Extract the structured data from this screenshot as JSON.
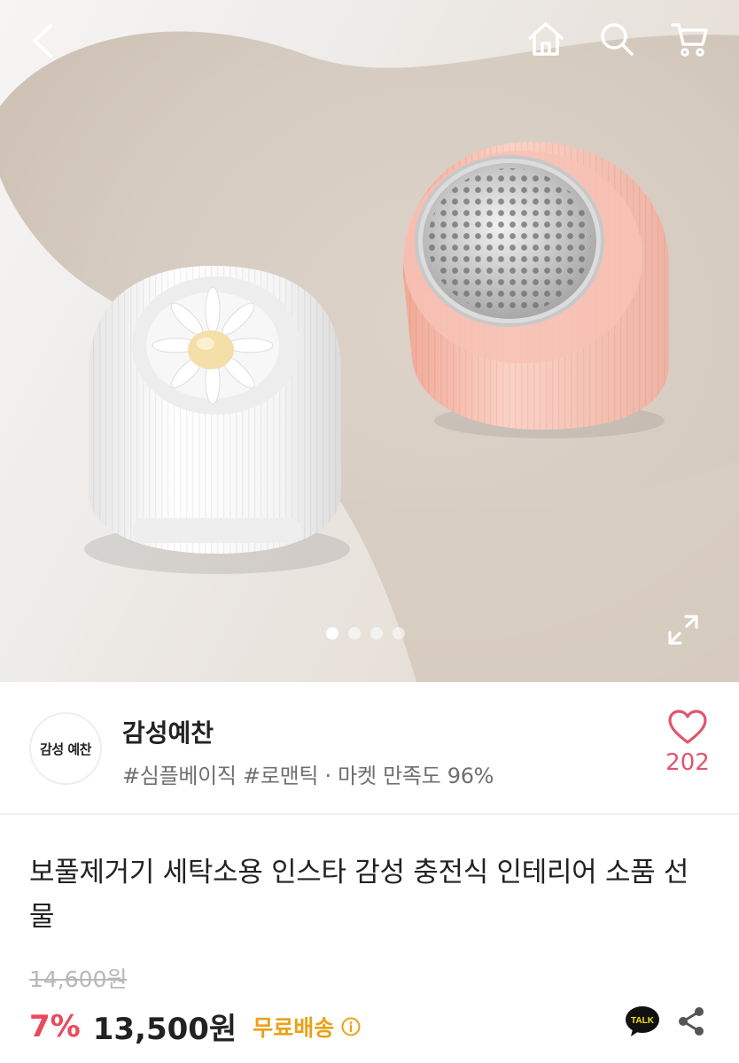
{
  "hero": {
    "carousel": {
      "count": 4,
      "active_index": 0
    }
  },
  "top_bar": {
    "icons": [
      "back-arrow-icon",
      "home-icon",
      "search-icon",
      "cart-icon"
    ]
  },
  "seller": {
    "logo_text": "감성 예찬",
    "name": "감성예찬",
    "tags": "#심플베이직 #로맨틱 · 마켓 만족도 96%",
    "likes": "202"
  },
  "product": {
    "title": "보풀제거기 세탁소용 인스타 감성 충전식 인테리어 소품 선물",
    "original_price": "14,600원",
    "discount": "7%",
    "price": "13,500원",
    "shipping": "무료배송"
  },
  "colors": {
    "accent_pink": "#ea4a5e",
    "shipping_gold": "#e9a21a",
    "talk_yellow": "#f7e017"
  }
}
